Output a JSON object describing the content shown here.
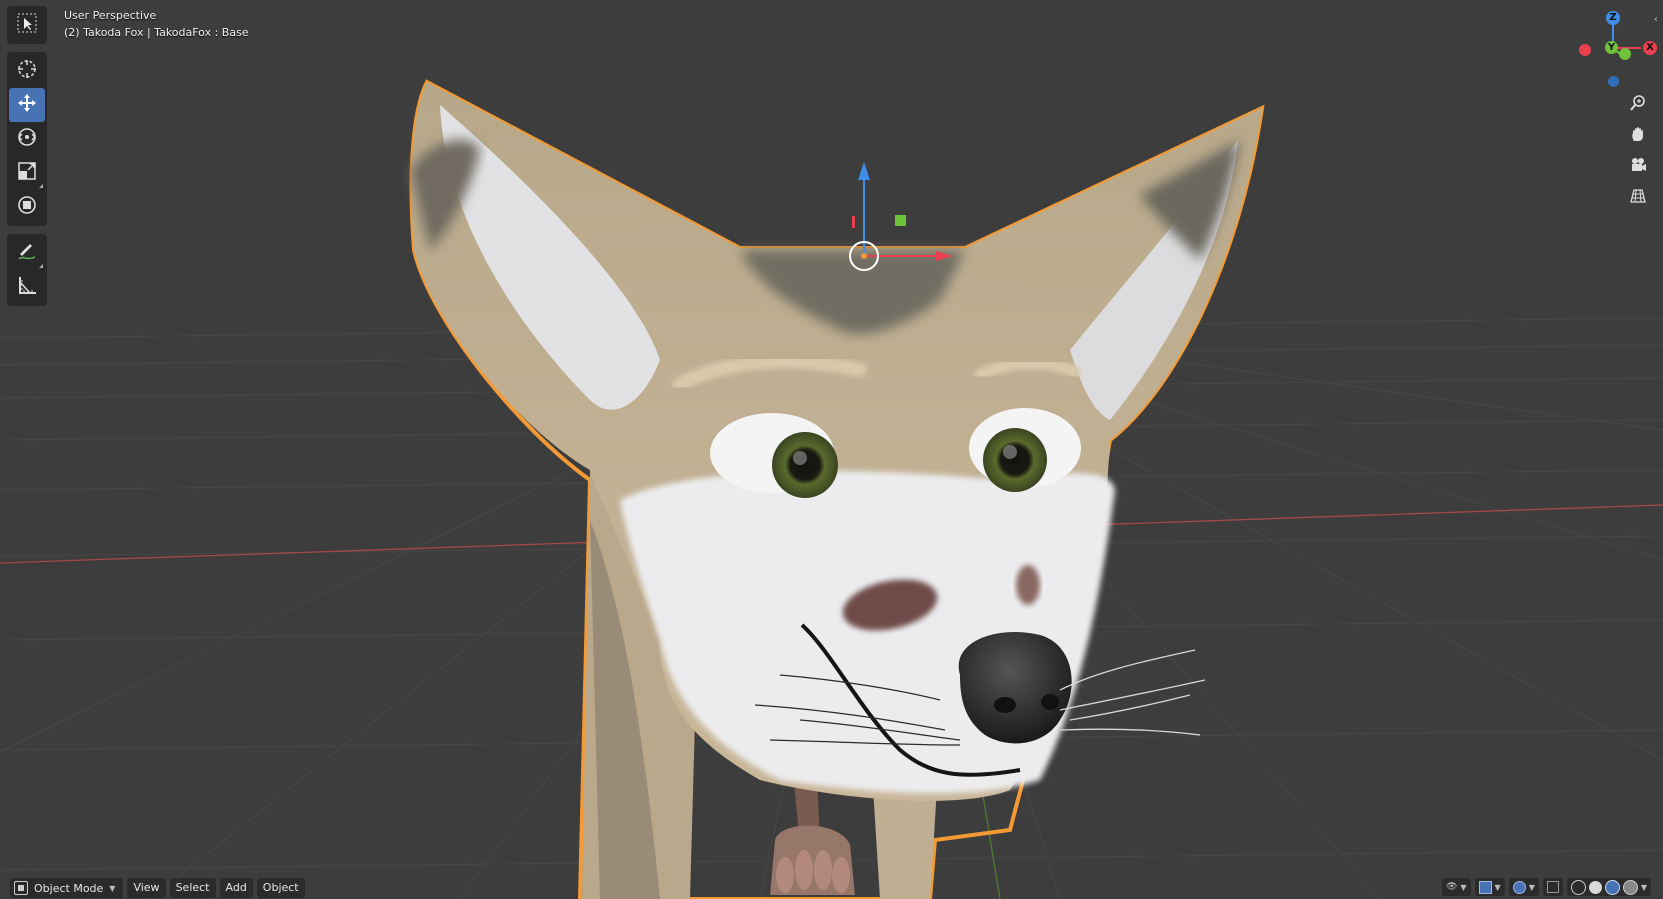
{
  "viewport": {
    "overlay_title": "User Perspective",
    "overlay_object": "(2) Takoda Fox | TakodaFox : Base"
  },
  "toolbar": {
    "tools": [
      {
        "name": "select-box",
        "icon": "select-box-icon",
        "active": false
      },
      {
        "name": "cursor",
        "icon": "cursor-icon",
        "active": false
      },
      {
        "name": "move",
        "icon": "move-icon",
        "active": true
      },
      {
        "name": "rotate",
        "icon": "rotate-icon",
        "active": false
      },
      {
        "name": "scale",
        "icon": "scale-icon",
        "active": false
      },
      {
        "name": "transform",
        "icon": "transform-icon",
        "active": false
      },
      {
        "name": "annotate",
        "icon": "annotate-icon",
        "active": false
      },
      {
        "name": "measure",
        "icon": "measure-icon",
        "active": false
      }
    ]
  },
  "nav_gizmo": {
    "z_label": "Z",
    "y_label": "Y",
    "x_label": "X",
    "colors": {
      "x": "#e8404f",
      "y": "#6ec23c",
      "z": "#3d8de9"
    }
  },
  "nav_buttons": [
    {
      "icon": "zoom-icon"
    },
    {
      "icon": "hand-pan-icon"
    },
    {
      "icon": "camera-icon"
    },
    {
      "icon": "grid-ortho-icon"
    }
  ],
  "header": {
    "mode": "Object Mode",
    "menus": [
      "View",
      "Select",
      "Add",
      "Object"
    ]
  },
  "colors": {
    "background": "#3d3d3d",
    "selection_outline": "#f39a35",
    "active_tool": "#4772b3",
    "x_axis_line": "#b34a4a",
    "y_axis_line": "#5a8a3a"
  }
}
